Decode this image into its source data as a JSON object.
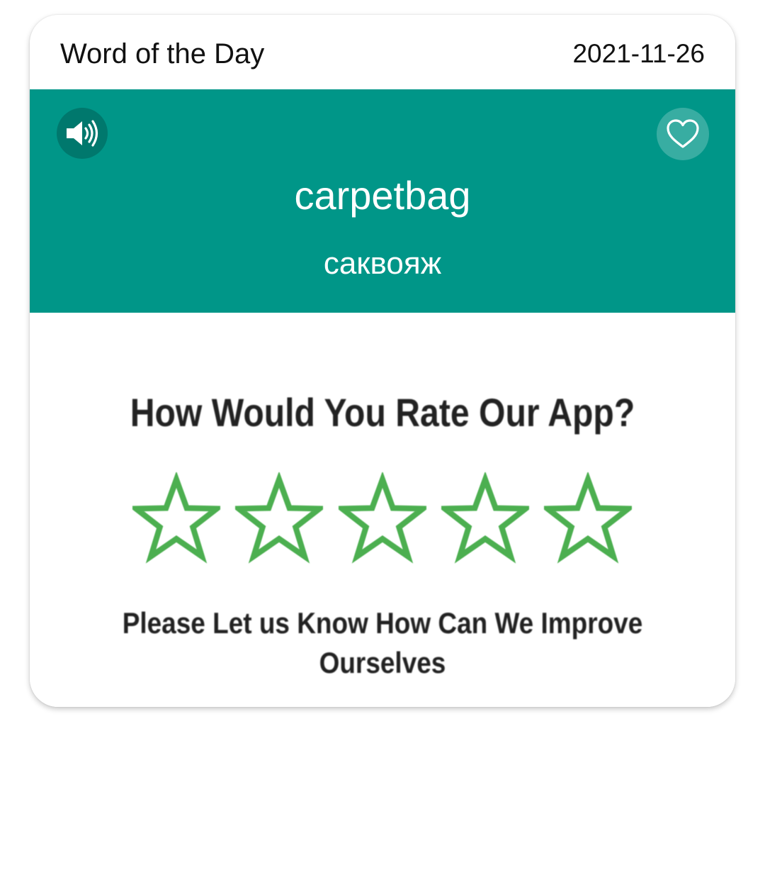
{
  "header": {
    "title": "Word of the Day",
    "date": "2021-11-26"
  },
  "word_card": {
    "word": "carpetbag",
    "translation": "саквояж",
    "sound_icon": "speaker-icon",
    "favorite_icon": "heart-outline-icon",
    "background_color": "#009688"
  },
  "rating_banner": {
    "title": "How Would You Rate Our App?",
    "subtitle": "Please Let us Know How Can We Improve Ourselves",
    "star_count": 5,
    "rating": 0,
    "star_color": "#4caf50"
  }
}
